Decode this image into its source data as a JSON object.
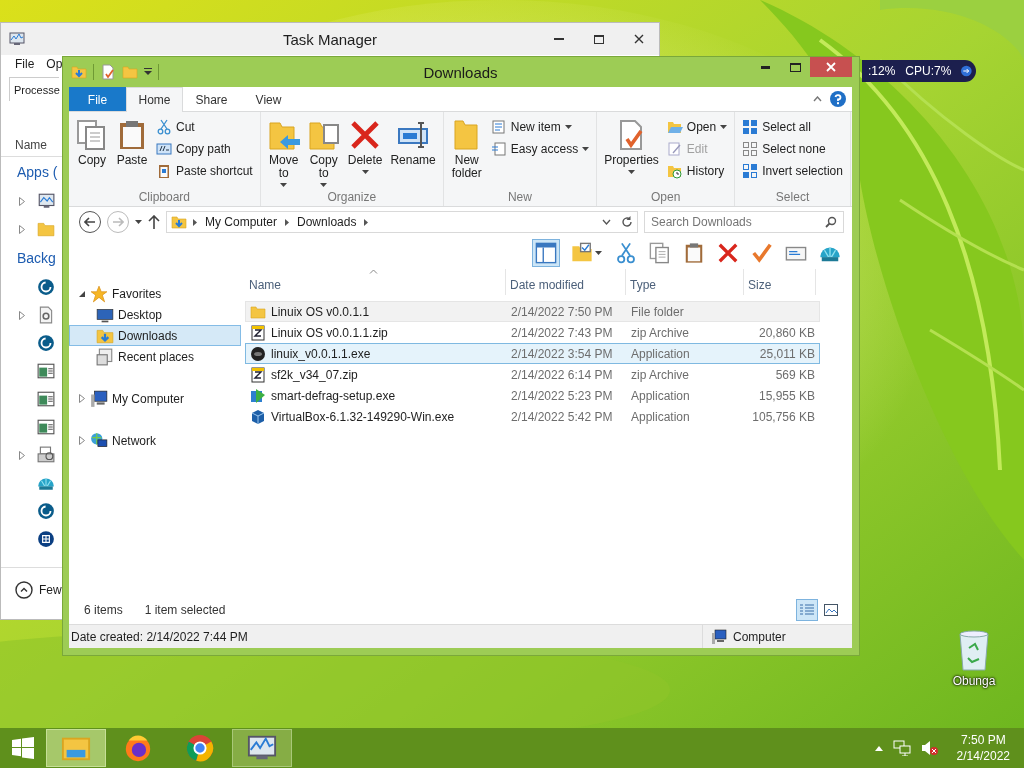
{
  "desktop": {
    "recycle_bin": {
      "label": "Obunga"
    },
    "gadget": {
      "memory": ":12%",
      "cpu": "CPU:7%"
    }
  },
  "task_manager": {
    "title": "Task Manager",
    "menu": [
      "File",
      "Op"
    ],
    "tab": "Processe",
    "column": "Name",
    "footer": "Few",
    "groups": [
      {
        "label": "Apps (",
        "rows": [
          {
            "kind": "monitor",
            "expandable": true
          },
          {
            "kind": "folder",
            "expandable": true
          }
        ]
      },
      {
        "label": "Backg",
        "rows": [
          {
            "kind": "disc",
            "expandable": false
          },
          {
            "kind": "gear-doc",
            "expandable": true
          },
          {
            "kind": "disc",
            "expandable": false
          },
          {
            "kind": "window",
            "expandable": false
          },
          {
            "kind": "window",
            "expandable": false
          },
          {
            "kind": "window",
            "expandable": false
          },
          {
            "kind": "printer",
            "expandable": true
          },
          {
            "kind": "shell",
            "expandable": false
          },
          {
            "kind": "disc",
            "expandable": false
          },
          {
            "kind": "grid",
            "expandable": false
          }
        ]
      }
    ]
  },
  "explorer": {
    "title": "Downloads",
    "ribbon_tabs": [
      {
        "label": "File",
        "kind": "file",
        "selected": false
      },
      {
        "label": "Home",
        "kind": "tab",
        "selected": true
      },
      {
        "label": "Share",
        "kind": "tab",
        "selected": false
      },
      {
        "label": "View",
        "kind": "tab",
        "selected": false
      }
    ],
    "ribbon_groups": [
      {
        "label": "Clipboard",
        "large": [
          {
            "label": "Copy",
            "kind": "copy",
            "dropdown": false
          },
          {
            "label": "Paste",
            "kind": "paste",
            "dropdown": false
          }
        ],
        "small": [
          {
            "label": "Cut",
            "kind": "cut",
            "dropdown": false,
            "disabled": false
          },
          {
            "label": "Copy path",
            "kind": "copy-path",
            "dropdown": false,
            "disabled": false
          },
          {
            "label": "Paste shortcut",
            "kind": "paste-shortcut",
            "dropdown": false,
            "disabled": false
          }
        ]
      },
      {
        "label": "Organize",
        "large": [
          {
            "label": "Move to",
            "kind": "move-to",
            "dropdown": true
          },
          {
            "label": "Copy to",
            "kind": "copy-to",
            "dropdown": true
          },
          {
            "label": "Delete",
            "kind": "delete",
            "dropdown": true
          },
          {
            "label": "Rename",
            "kind": "rename",
            "dropdown": false
          }
        ]
      },
      {
        "label": "New",
        "large": [
          {
            "label": "New folder",
            "kind": "new-folder",
            "dropdown": false
          }
        ],
        "small": [
          {
            "label": "New item",
            "kind": "new-item",
            "dropdown": true,
            "disabled": false
          },
          {
            "label": "Easy access",
            "kind": "easy-access",
            "dropdown": true,
            "disabled": false
          }
        ]
      },
      {
        "label": "Open",
        "large": [
          {
            "label": "Properties",
            "kind": "properties",
            "dropdown": true
          }
        ],
        "small": [
          {
            "label": "Open",
            "kind": "open",
            "dropdown": true,
            "disabled": false
          },
          {
            "label": "Edit",
            "kind": "edit",
            "dropdown": false,
            "disabled": true
          },
          {
            "label": "History",
            "kind": "history",
            "dropdown": false,
            "disabled": false
          }
        ]
      },
      {
        "label": "Select",
        "small": [
          {
            "label": "Select all",
            "kind": "select-all",
            "dropdown": false,
            "disabled": false
          },
          {
            "label": "Select none",
            "kind": "select-none",
            "dropdown": false,
            "disabled": false
          },
          {
            "label": "Invert selection",
            "kind": "invert",
            "dropdown": false,
            "disabled": false
          }
        ]
      }
    ],
    "nav_buttons": [
      {
        "kind": "back",
        "disabled": false
      },
      {
        "kind": "forward",
        "disabled": true
      }
    ],
    "path": [
      "My Computer",
      "Downloads"
    ],
    "search_placeholder": "Search Downloads",
    "toolbar": [
      {
        "kind": "pane",
        "selected": true
      },
      {
        "kind": "folder-check",
        "selected": false
      },
      {
        "kind": "cut",
        "selected": false
      },
      {
        "kind": "copy",
        "selected": false
      },
      {
        "kind": "paste",
        "selected": false
      },
      {
        "kind": "delete",
        "selected": false
      },
      {
        "kind": "check",
        "selected": false
      },
      {
        "kind": "card",
        "selected": false
      },
      {
        "kind": "shell",
        "selected": false
      }
    ],
    "nav_tree": [
      {
        "label": "Favorites",
        "kind": "star",
        "expanded": true,
        "selected": false,
        "children": [
          {
            "label": "Desktop",
            "kind": "desktop",
            "selected": false
          },
          {
            "label": "Downloads",
            "kind": "downloads",
            "selected": true
          },
          {
            "label": "Recent places",
            "kind": "recent",
            "selected": false
          }
        ]
      },
      {
        "label": "My Computer",
        "kind": "computer",
        "expanded": false,
        "selected": false
      },
      {
        "label": "Network",
        "kind": "network",
        "expanded": false,
        "selected": false
      }
    ],
    "columns": [
      {
        "label": "Name",
        "sorted": true
      },
      {
        "label": "Date modified",
        "sorted": false
      },
      {
        "label": "Type",
        "sorted": false
      },
      {
        "label": "Size",
        "sorted": false
      }
    ],
    "files": [
      {
        "name": "Linuix OS v0.0.1.1",
        "date": "2/14/2022 7:50 PM",
        "type": "File folder",
        "kind": "folder",
        "selected": false,
        "hover": true
      },
      {
        "name": "Linuix OS v0.0.1.1.zip",
        "date": "2/14/2022 7:43 PM",
        "type": "zip Archive",
        "size": "20,860 KB",
        "kind": "zip",
        "selected": false,
        "hover": false
      },
      {
        "name": "linuix_v0.0.1.1.exe",
        "date": "2/14/2022 3:54 PM",
        "type": "Application",
        "size": "25,011 KB",
        "kind": "app-dark",
        "selected": true,
        "hover": false
      },
      {
        "name": "sf2k_v34_07.zip",
        "date": "2/14/2022 6:14 PM",
        "type": "zip Archive",
        "size": "569 KB",
        "kind": "zip",
        "selected": false,
        "hover": false
      },
      {
        "name": "smart-defrag-setup.exe",
        "date": "2/14/2022 5:23 PM",
        "type": "Application",
        "size": "15,955 KB",
        "kind": "defrag",
        "selected": false,
        "hover": false
      },
      {
        "name": "VirtualBox-6.1.32-149290-Win.exe",
        "date": "2/14/2022 5:42 PM",
        "type": "Application",
        "size": "105,756 KB",
        "kind": "vbox",
        "selected": false,
        "hover": false
      }
    ],
    "status": {
      "count": "6 items",
      "selection": "1 item selected",
      "views": [
        {
          "kind": "details",
          "selected": true
        },
        {
          "kind": "large-icons",
          "selected": false
        }
      ]
    },
    "details_bar": {
      "info": "Date created: 2/14/2022 7:44 PM",
      "location": "Computer"
    }
  },
  "taskbar": {
    "items": [
      {
        "kind": "explorer",
        "selected": true,
        "running": true
      },
      {
        "kind": "firefox",
        "selected": false,
        "running": false
      },
      {
        "kind": "chrome",
        "selected": false,
        "running": false
      },
      {
        "kind": "task-manager",
        "selected": false,
        "running": true
      }
    ],
    "time": "7:50 PM",
    "date": "2/14/2022"
  }
}
